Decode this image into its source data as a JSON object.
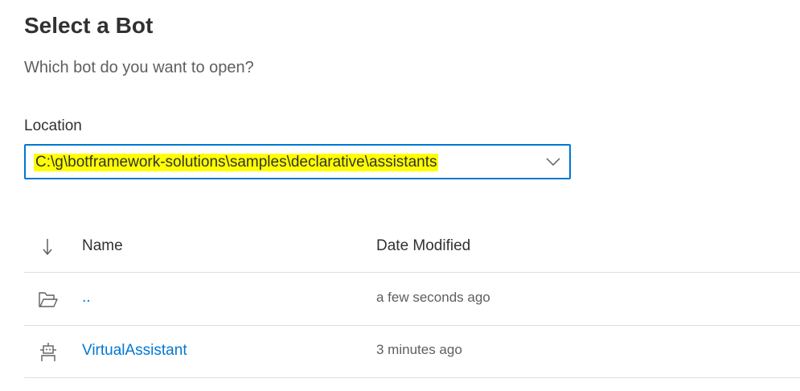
{
  "page": {
    "title": "Select a Bot",
    "subtitle": "Which bot do you want to open?"
  },
  "location": {
    "label": "Location",
    "value": "C:\\g\\botframework-solutions\\samples\\declarative\\assistants",
    "highlight_color": "#ffff00",
    "accent_color": "#0078d4"
  },
  "table": {
    "sort_icon": "arrow-down-icon",
    "columns": {
      "name": "Name",
      "date": "Date Modified"
    },
    "rows": [
      {
        "icon": "folder-open-icon",
        "name": "..",
        "date": "a few seconds ago"
      },
      {
        "icon": "bot-icon",
        "name": "VirtualAssistant",
        "date": "3 minutes ago"
      }
    ]
  }
}
